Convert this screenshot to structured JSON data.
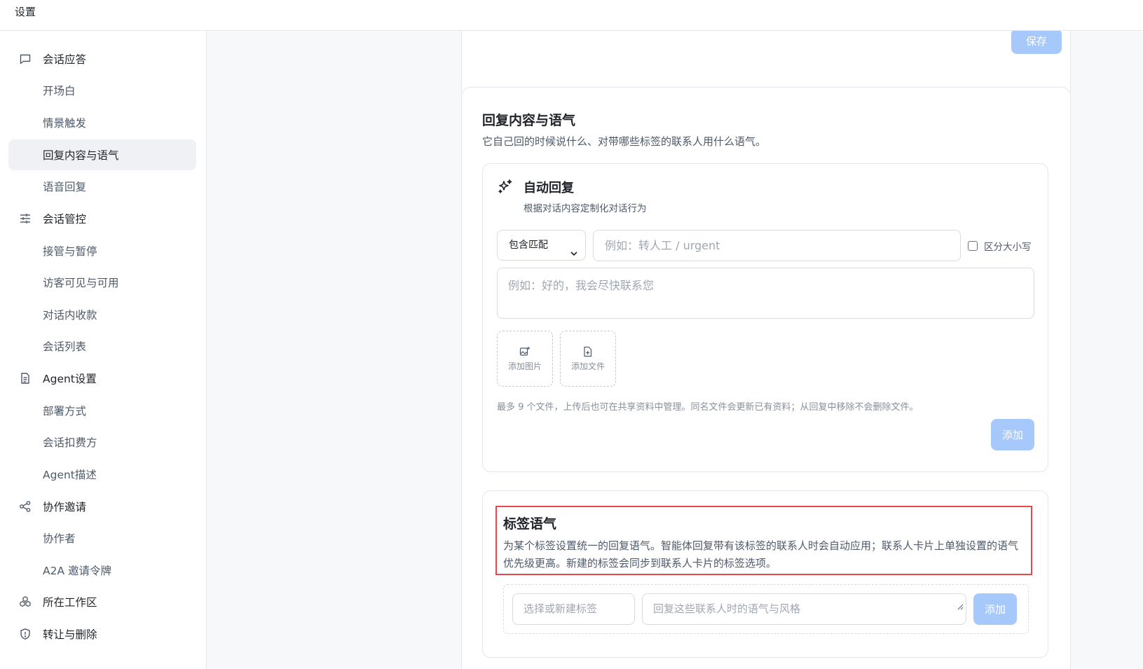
{
  "window": {
    "title": "设置"
  },
  "sidebar": {
    "items": [
      {
        "label": "会话应答",
        "icon": "chat-bubble-icon",
        "type": "group"
      },
      {
        "label": "开场白",
        "type": "sub"
      },
      {
        "label": "情景触发",
        "type": "sub"
      },
      {
        "label": "回复内容与语气",
        "type": "sub",
        "active": true
      },
      {
        "label": "语音回复",
        "type": "sub"
      },
      {
        "label": "会话管控",
        "icon": "sliders-icon",
        "type": "group"
      },
      {
        "label": "接管与暂停",
        "type": "sub"
      },
      {
        "label": "访客可见与可用",
        "type": "sub"
      },
      {
        "label": "对话内收款",
        "type": "sub"
      },
      {
        "label": "会话列表",
        "type": "sub"
      },
      {
        "label": "Agent设置",
        "icon": "document-icon",
        "type": "group"
      },
      {
        "label": "部署方式",
        "type": "sub"
      },
      {
        "label": "会话扣费方",
        "type": "sub"
      },
      {
        "label": "Agent描述",
        "type": "sub"
      },
      {
        "label": "协作邀请",
        "icon": "share-icon",
        "type": "group"
      },
      {
        "label": "协作者",
        "type": "sub"
      },
      {
        "label": "A2A 邀请令牌",
        "type": "sub"
      },
      {
        "label": "所在工作区",
        "icon": "cubes-icon",
        "type": "group"
      },
      {
        "label": "转让与删除",
        "icon": "shield-icon",
        "type": "group"
      }
    ]
  },
  "top_card": {
    "save_label": "保存"
  },
  "section": {
    "title": "回复内容与语气",
    "desc": "它自己回的时候说什么、对带哪些标签的联系人用什么语气。",
    "auto_reply": {
      "icon": "sparkle-icon",
      "title": "自动回复",
      "desc": "根据对话内容定制化对话行为",
      "match_select": "包含匹配",
      "keyword_placeholder": "例如：转人工 / urgent",
      "case_label": "区分大小写",
      "reply_placeholder": "例如：好的，我会尽快联系您",
      "add_image_label": "添加图片",
      "add_file_label": "添加文件",
      "hint": "最多 9 个文件，上传后也可在共享资料中管理。同名文件会更新已有资料；从回复中移除不会删除文件。",
      "add_label": "添加"
    },
    "tag_tone": {
      "title": "标签语气",
      "desc": "为某个标签设置统一的回复语气。智能体回复带有该标签的联系人时会自动应用；联系人卡片上单独设置的语气优先级更高。新建的标签会同步到联系人卡片的标签选项。",
      "tag_placeholder": "选择或新建标签",
      "tone_placeholder": "回复这些联系人时的语气与风格",
      "add_label": "添加"
    }
  },
  "colors": {
    "primary_disabled": "#a6c8fb",
    "highlight": "#e5484d",
    "active_bg": "#f0f1f4"
  }
}
